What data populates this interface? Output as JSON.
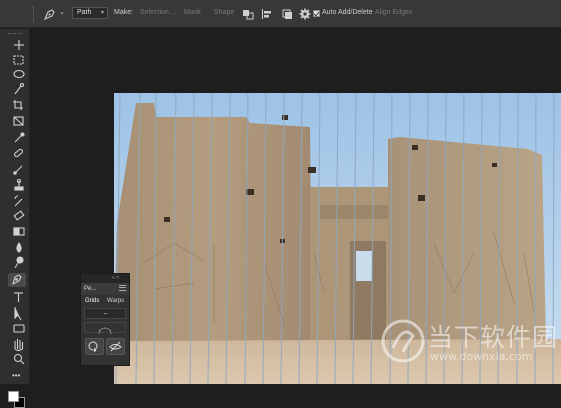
{
  "options_bar": {
    "tool_icon": "pen-tool-icon",
    "mode_value": "Path",
    "make_label": "Make:",
    "selection_label": "Selection ...",
    "mask_label": "Mask",
    "shape_label": "Shape",
    "path_operations_icon": "path-operations-icon",
    "path_alignment_icon": "path-alignment-icon",
    "path_arrangement_icon": "path-arrangement-icon",
    "settings_icon": "gear-icon",
    "auto_add_delete_label": "Auto Add/Delete",
    "auto_add_delete_checked": true,
    "align_edges_label": "Align Edges"
  },
  "toolbar": {
    "tools": [
      "move-icon",
      "marquee-icon",
      "lasso-icon",
      "quick-select-icon",
      "crop-icon",
      "frame-icon",
      "eyedropper-icon",
      "healing-brush-icon",
      "brush-icon",
      "clone-stamp-icon",
      "history-brush-icon",
      "eraser-icon",
      "gradient-icon",
      "blur-icon",
      "dodge-icon",
      "pen-icon",
      "type-icon",
      "path-selection-icon",
      "rectangle-icon",
      "hand-icon",
      "zoom-icon",
      "more-tools-icon"
    ],
    "active_tool": "pen-icon",
    "foreground_color": "#ffffff",
    "background_color": "#000000"
  },
  "panel": {
    "title": "Pe...",
    "tabs": [
      "Grids",
      "Warps"
    ],
    "active_tab": "Grids",
    "controls": "« ×"
  },
  "watermark": {
    "text": "当下软件园",
    "url": "www.downxia.com"
  }
}
